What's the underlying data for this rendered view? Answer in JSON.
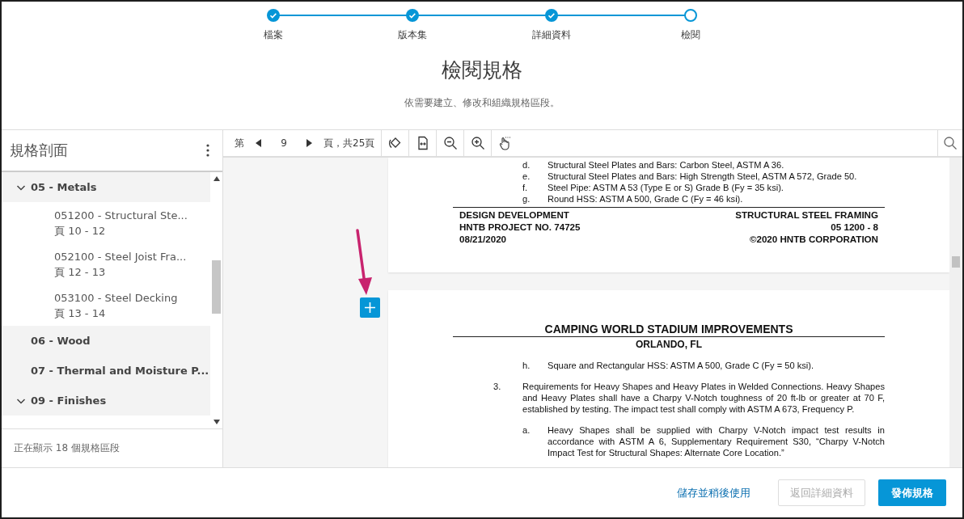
{
  "stepper": {
    "steps": [
      {
        "label": "檔案",
        "completed": true
      },
      {
        "label": "版本集",
        "completed": true
      },
      {
        "label": "詳細資料",
        "completed": true
      },
      {
        "label": "檢閱",
        "completed": false
      }
    ]
  },
  "title": "檢閱規格",
  "subtitle": "依需要建立、修改和組織規格區段。",
  "sidebar": {
    "title": "規格剖面",
    "items": [
      {
        "label": "05 - Metals",
        "expanded": true,
        "children": [
          {
            "label": "051200 - Structural Ste...",
            "pages": "頁 10 - 12"
          },
          {
            "label": "052100 - Steel Joist Fra...",
            "pages": "頁 12 - 13"
          },
          {
            "label": "053100 - Steel Decking",
            "pages": "頁 13 - 14"
          }
        ]
      },
      {
        "label": "06 - Wood",
        "expanded": false
      },
      {
        "label": "07 - Thermal and Moisture P...",
        "expanded": false
      },
      {
        "label": "09 - Finishes",
        "expanded": true
      }
    ],
    "footer": "正在顯示 18 個規格區段"
  },
  "toolbar": {
    "page_prefix": "第",
    "page": "9",
    "page_suffix": "頁，共25頁"
  },
  "document": {
    "pages": [
      {
        "items": [
          {
            "kind": "sub",
            "marker": "d.",
            "text": "Structural Steel Plates and Bars:  Carbon Steel, ASTM A 36."
          },
          {
            "kind": "sub",
            "marker": "e.",
            "text": "Structural Steel Plates and Bars:  High Strength Steel, ASTM A 572, Grade 50."
          },
          {
            "kind": "sub",
            "marker": "f.",
            "text": "Steel Pipe:  ASTM A 53 (Type E or S) Grade B (Fy = 35 ksi)."
          },
          {
            "kind": "sub",
            "marker": "g.",
            "text": "Round HSS:  ASTM A 500, Grade C (Fy = 46 ksi)."
          }
        ],
        "footer": {
          "left": [
            "DESIGN DEVELOPMENT",
            "HNTB PROJECT NO. 74725",
            "08/21/2020"
          ],
          "right": [
            "STRUCTURAL STEEL FRAMING",
            "05 1200 - 8",
            "©2020 HNTB CORPORATION"
          ]
        }
      },
      {
        "header": {
          "title": "CAMPING WORLD STADIUM IMPROVEMENTS",
          "subtitle": "ORLANDO, FL"
        },
        "items": [
          {
            "kind": "sub",
            "marker": "h.",
            "text": "Square and Rectangular HSS:  ASTM A 500, Grade C (Fy = 50 ksi)."
          },
          {
            "kind": "main",
            "marker": "3.",
            "text": "Requirements for Heavy Shapes and Heavy Plates in Welded Connections. Heavy Shapes and Heavy Plates shall have a Charpy V-Notch toughness of 20 ft-lb or greater at 70 F, established by testing. The impact test shall comply with ASTM A 673, Frequency P."
          },
          {
            "kind": "sub",
            "marker": "a.",
            "text": "Heavy Shapes shall be supplied with Charpy V-Notch impact test results in accordance with ASTM A 6, Supplementary Requirement S30, “Charpy V-Notch Impact Test for Structural Shapes: Alternate Core Location.”"
          }
        ]
      }
    ]
  },
  "actions": {
    "link": "儲存並稍後使用",
    "secondary": {
      "label": "返回詳細資料",
      "disabled": true
    },
    "primary": "發佈規格"
  }
}
